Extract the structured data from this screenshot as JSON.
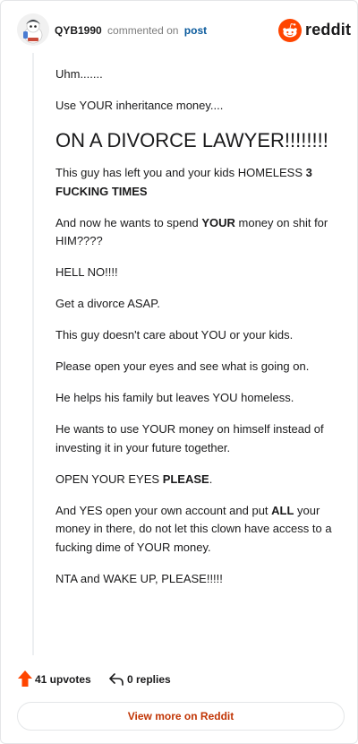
{
  "header": {
    "username": "QYB1990",
    "verb": "commented on",
    "link": "post",
    "brand": "reddit"
  },
  "comment": {
    "paragraphs": [
      [
        {
          "t": "Uhm......."
        }
      ],
      [
        {
          "t": "Use YOUR inheritance money...."
        }
      ],
      [
        {
          "t": "ON A DIVORCE LAWYER!!!!!!!!"
        }
      ],
      [
        {
          "t": "This guy has left you and your kids HOMELESS "
        },
        {
          "t": "3 FUCKING TIMES",
          "b": true
        }
      ],
      [
        {
          "t": "And now he wants to spend "
        },
        {
          "t": "YOUR",
          "b": true
        },
        {
          "t": " money on shit for HIM????"
        }
      ],
      [
        {
          "t": "HELL NO!!!!"
        }
      ],
      [
        {
          "t": "Get a divorce ASAP."
        }
      ],
      [
        {
          "t": "This guy doesn't care about YOU or your kids."
        }
      ],
      [
        {
          "t": "Please open your eyes and see what is going on."
        }
      ],
      [
        {
          "t": "He helps his family but leaves YOU homeless."
        }
      ],
      [
        {
          "t": "He wants to use YOUR money on himself instead of investing it in your future together."
        }
      ],
      [
        {
          "t": "OPEN YOUR EYES "
        },
        {
          "t": "PLEASE",
          "b": true
        },
        {
          "t": "."
        }
      ],
      [
        {
          "t": "And YES open your own account and put "
        },
        {
          "t": "ALL",
          "b": true
        },
        {
          "t": " your money in there, do not let this clown have access to a fucking dime of YOUR money."
        }
      ],
      [
        {
          "t": "NTA and WAKE UP, PLEASE!!!!!"
        }
      ]
    ]
  },
  "footer": {
    "upvotes": "41 upvotes",
    "replies": "0 replies",
    "view_more": "View more on Reddit"
  },
  "colors": {
    "upvote": "#ff4500",
    "link": "#0a5a9c",
    "view_more": "#c13505",
    "brand": "#ff4500"
  }
}
